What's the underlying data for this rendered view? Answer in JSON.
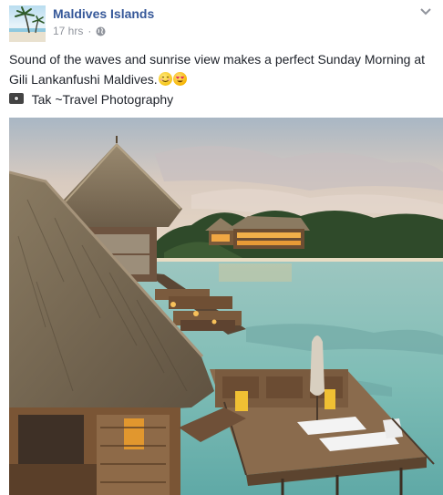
{
  "post": {
    "page_name": "Maldives Islands",
    "time": "17 hrs",
    "separator": "·",
    "text_line1": "Sound of the waves and sunrise view makes a perfect Sunday Morning at",
    "text_line2": "Gili Lankanfushi Maldives.",
    "credit": "Tak ~Travel Photography",
    "icons": {
      "privacy": "globe-icon",
      "menu": "chevron-down-icon",
      "emoji1": "smiling-face-icon",
      "emoji2": "heart-eyes-face-icon",
      "credit": "camera-icon"
    }
  },
  "colors": {
    "link": "#365899",
    "meta": "#90949c",
    "text": "#1d2129"
  }
}
